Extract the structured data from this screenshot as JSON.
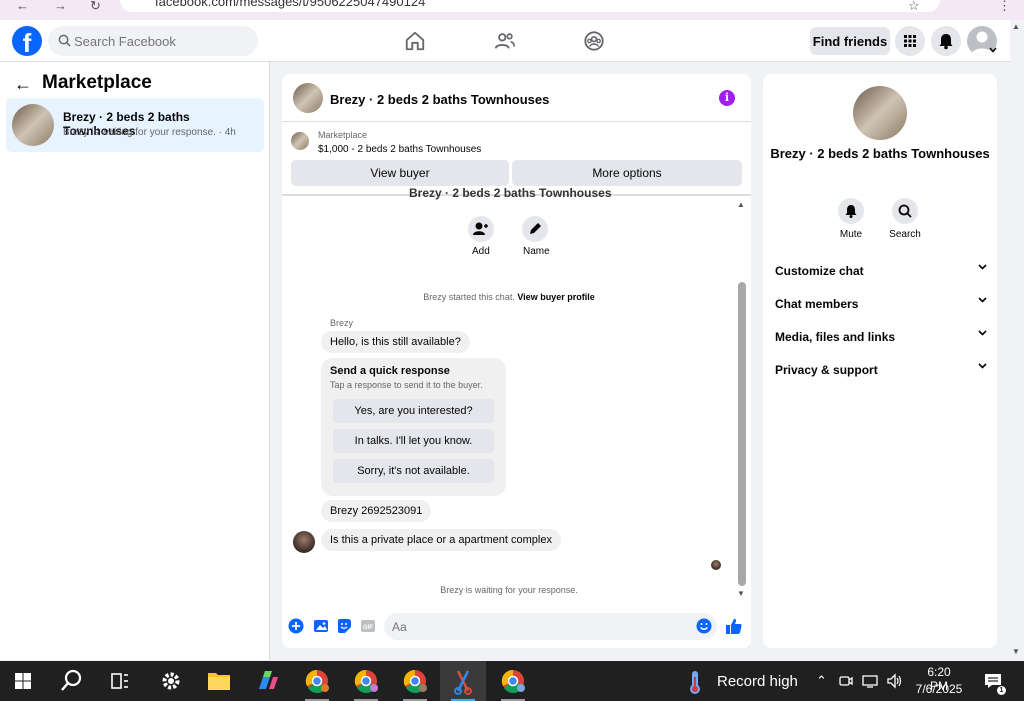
{
  "browser": {
    "url": "facebook.com/messages/t/9506225047490124"
  },
  "topbar": {
    "search_placeholder": "Search Facebook",
    "find_friends": "Find friends"
  },
  "left_panel": {
    "title": "Marketplace",
    "conversation": {
      "title": "Brezy · 2 beds 2 baths Townhouses",
      "subtitle": "Brezy is waiting for your response. · 4h"
    }
  },
  "chat": {
    "title": "Brezy · 2 beds 2 baths Townhouses",
    "listing_label": "Marketplace",
    "listing_price": "$1,000 - 2 beds 2 baths Townhouses",
    "view_buyer": "View buyer",
    "more_options": "More options",
    "cut_title": "Brezy · 2 beds 2 baths Townhouses",
    "add_label": "Add",
    "name_label": "Name",
    "started_text": "Brezy started this chat.",
    "view_buyer_profile": "View buyer profile",
    "sender": "Brezy",
    "msg1": "Hello, is this still available?",
    "quick_title": "Send a quick response",
    "quick_sub": "Tap a response to send it to the buyer.",
    "quick_responses": [
      "Yes, are you interested?",
      "In talks. I'll let you know.",
      "Sorry, it's not available."
    ],
    "msg2": "Brezy 2692523091",
    "msg3": "Is this a private place or a apartment complex",
    "waiting": "Brezy is waiting for your response.",
    "composer_placeholder": "Aa"
  },
  "right_panel": {
    "title": "Brezy · 2 beds 2 baths Townhouses",
    "mute": "Mute",
    "search": "Search",
    "sections": [
      "Customize chat",
      "Chat members",
      "Media, files and links",
      "Privacy & support"
    ]
  },
  "taskbar": {
    "weather": "Record high",
    "time": "6:20 PM",
    "date": "7/6/2025"
  },
  "colors": {
    "accent": "#0866ff",
    "info": "#a020f0",
    "taskbar": "#202020"
  }
}
